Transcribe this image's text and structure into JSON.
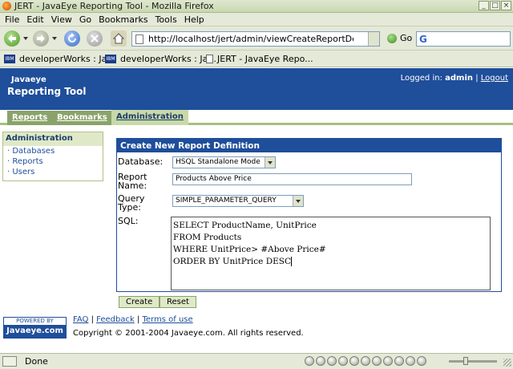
{
  "window": {
    "title": "JERT - JavaEye Reporting Tool - Mozilla Firefox",
    "controls": [
      "_",
      "□",
      "×"
    ]
  },
  "menubar": [
    "File",
    "Edit",
    "View",
    "Go",
    "Bookmarks",
    "Tools",
    "Help"
  ],
  "toolbar": {
    "url": "http://localhost/jert/admin/viewCreateReportDefinition.action?",
    "go_label": "Go",
    "search_icon": "G"
  },
  "bookmarks": [
    {
      "label": "developerWorks : Ja...",
      "icon": "IBM"
    },
    {
      "label": "developerWorks : Ja...",
      "icon": "IBM"
    },
    {
      "label": "JERT - JavaEye Repo...",
      "icon": "doc-icon"
    }
  ],
  "header": {
    "brand_small": "Javaeye",
    "brand_big": "Reporting Tool",
    "logged_in_label": "Logged in:",
    "user": "admin",
    "separator": "|",
    "logout": "Logout",
    "color": "#1f4e9a"
  },
  "tabs": [
    {
      "label": "Reports",
      "active": false
    },
    {
      "label": "Bookmarks",
      "active": false
    },
    {
      "label": "Administration",
      "active": true
    }
  ],
  "sidebar": {
    "title": "Administration",
    "items": [
      "· Databases",
      "· Reports",
      "· Users"
    ]
  },
  "form": {
    "title": "Create New Report Definition",
    "database_label": "Database:",
    "database_value": "HSQL Standalone Mode",
    "report_name_label_1": "Report",
    "report_name_label_2": "Name:",
    "report_name_value": "Products Above Price",
    "query_type_label_1": "Query",
    "query_type_label_2": "Type:",
    "query_type_value": "SIMPLE_PARAMETER_QUERY",
    "sql_label": "SQL:",
    "sql_lines": [
      "SELECT ProductName, UnitPrice",
      "FROM Products",
      "WHERE UnitPrice> #Above Price#",
      "ORDER BY UnitPrice DESC"
    ],
    "create_button": "Create",
    "reset_button": "Reset"
  },
  "footer": {
    "powered_by": "POWERED BY",
    "powered_brand": "Javaeye.com",
    "faq": "FAQ",
    "sep": "|",
    "feedback": "Feedback",
    "terms": "Terms of use",
    "copyright": "Copyright © 2001-2004 Javaeye.com. All rights reserved."
  },
  "status": {
    "text": "Done"
  }
}
